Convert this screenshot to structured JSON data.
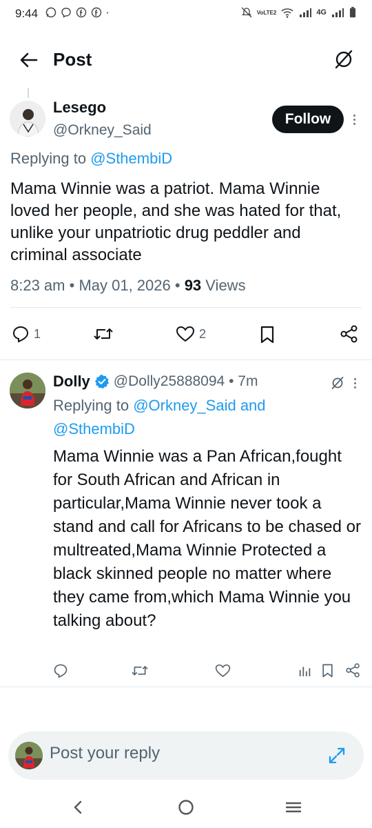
{
  "status_bar": {
    "time": "9:44",
    "network_label": "4G",
    "volte_label": "VoLTE2"
  },
  "header": {
    "title": "Post"
  },
  "main_post": {
    "author_name": "Lesego",
    "author_handle": "@Orkney_Said",
    "follow_label": "Follow",
    "replying_prefix": "Replying to ",
    "replying_to": "@SthembiD",
    "text": "Mama Winnie was a patriot. Mama Winnie loved her people, and she was hated for that, unlike your unpatriotic drug peddler and criminal associate",
    "time": "8:23 am",
    "date": "May 01, 2026",
    "views_count": "93",
    "views_label": " Views",
    "replies_count": "1",
    "likes_count": "2"
  },
  "reply_post": {
    "author_name": "Dolly",
    "author_handle": "@Dolly25888094",
    "relative_time": "7m",
    "replying_prefix": "Replying to ",
    "replying_to_1": "@Orkney_Said",
    "replying_and": " and",
    "replying_to_2": "@SthembiD",
    "text": "Mama Winnie was a Pan African,fought for South African and African in particular,Mama Winnie never took a stand and call for Africans to be chased or multreated,Mama Winnie Protected a black skinned people no matter where they came from,which Mama Winnie you talking about?"
  },
  "reply_bar": {
    "placeholder": "Post your reply"
  },
  "colors": {
    "accent": "#1d9bf0",
    "text_primary": "#0f1419",
    "text_secondary": "#536471",
    "follow_bg": "#0f1419",
    "reply_bar_bg": "#eff3f4"
  }
}
